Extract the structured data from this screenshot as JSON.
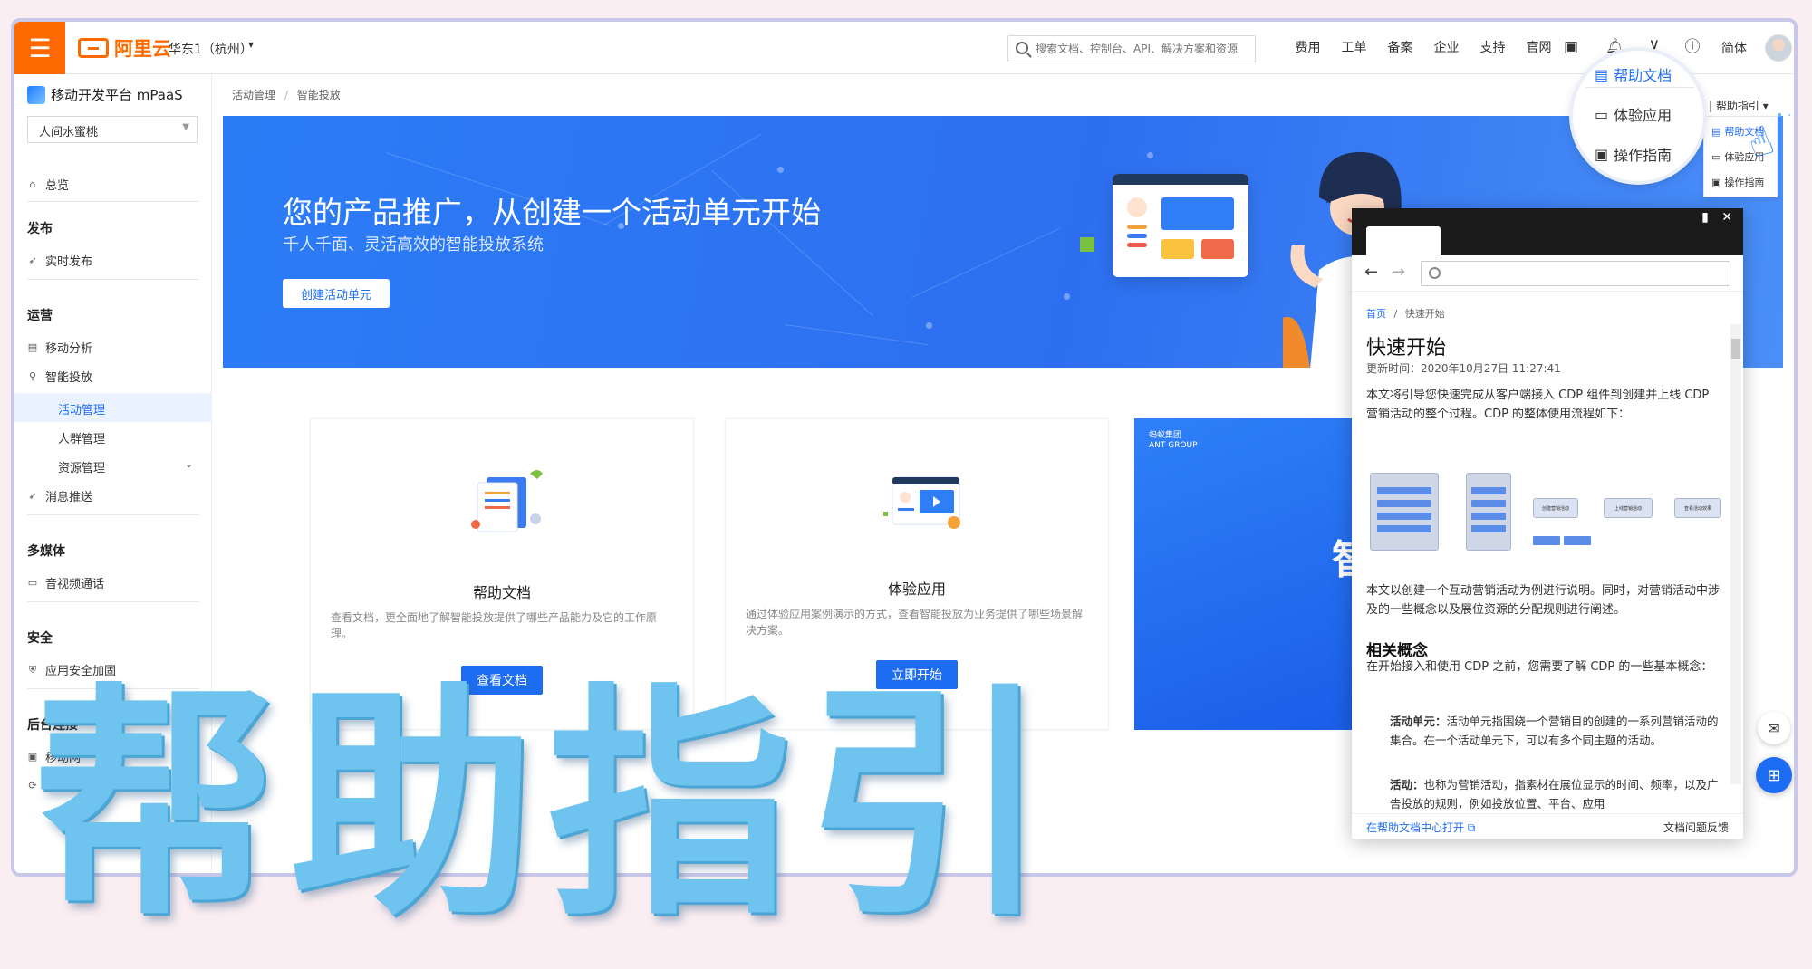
{
  "topbar": {
    "menu_icon": "hamburger-icon",
    "logo_text": "阿里云",
    "region": "华东1（杭州）",
    "search_placeholder": "搜索文档、控制台、API、解决方案和资源",
    "nav": [
      "费用",
      "工单",
      "备案",
      "企业",
      "支持",
      "官网"
    ],
    "icons": [
      "terminal-icon",
      "bell-icon",
      "cart-icon",
      "help-icon"
    ],
    "lang": "简体"
  },
  "sidebar": {
    "product": "移动开发平台 mPaaS",
    "app_selected": "人间水蜜桃",
    "overview": "总览",
    "groups": {
      "publish": "发布",
      "ops": "运营",
      "media": "多媒体",
      "security": "安全",
      "backend": "后台连接"
    },
    "items": {
      "realtime_publish": "实时发布",
      "mobile_analysis": "移动分析",
      "smart_delivery": "智能投放",
      "activity_mgmt": "活动管理",
      "crowd_mgmt": "人群管理",
      "resource_mgmt": "资源管理",
      "message_push": "消息推送",
      "av_call": "音视频通话",
      "app_hardening": "应用安全加固",
      "mobile_gateway": "移动网",
      "database": "数据同"
    }
  },
  "breadcrumb": {
    "parent": "活动管理",
    "sep": "/",
    "current": "智能投放"
  },
  "banner": {
    "title": "您的产品推广，从创建一个活动单元开始",
    "subtitle": "千人千面、灵活高效的智能投放系统",
    "button": "创建活动单元"
  },
  "cards": [
    {
      "title": "帮助文档",
      "desc": "查看文档，更全面地了解智能投放提供了哪些产品能力及它的工作原理。",
      "button": "查看文档"
    },
    {
      "title": "体验应用",
      "desc": "通过体验应用案例演示的方式，查看智能投放为业务提供了哪些场景解决方案。",
      "button": "立即开始"
    }
  ],
  "promo": {
    "logo_line1": "蚂蚁集团",
    "logo_line2": "ANT GROUP",
    "glyph": "智"
  },
  "help_guide": {
    "label": "帮助指引",
    "items": [
      "帮助文档",
      "体验应用",
      "操作指南"
    ]
  },
  "help_panel": {
    "crumb_home": "首页",
    "crumb_sep": "/",
    "crumb_current": "快速开始",
    "title": "快速开始",
    "updated": "更新时间：2020年10月27日 11:27:41",
    "intro": "本文将引导您快速完成从客户端接入 CDP 组件到创建并上线 CDP 营销活动的整个过程。CDP 的整体使用流程如下：",
    "para2": "本文以创建一个互动营销活动为例进行说明。同时，对营销活动中涉及的一些概念以及展位资源的分配规则进行阐述。",
    "concepts_heading": "相关概念",
    "concepts_intro": "在开始接入和使用 CDP 之前，您需要了解 CDP 的一些基本概念：",
    "concepts": [
      {
        "term": "活动单元：",
        "text": "活动单元指围绕一个营销目的创建的一系列营销活动的集合。在一个活动单元下，可以有多个同主题的活动。"
      },
      {
        "term": "活动：",
        "text": "也称为营销活动，指素材在展位显示的时间、频率，以及广告投放的规则，例如投放位置、平台、应用"
      }
    ],
    "flow_labels": [
      "创建营销活动",
      "上线营销活动",
      "查看活动效果"
    ],
    "open_in_center": "在帮助文档中心打开",
    "feedback": "文档问题反馈"
  },
  "overlay_title": "帮助指引",
  "colors": {
    "brand_orange": "#ff6a00",
    "primary_blue": "#1e6cf2",
    "overlay_text": "#6ec4ee"
  }
}
